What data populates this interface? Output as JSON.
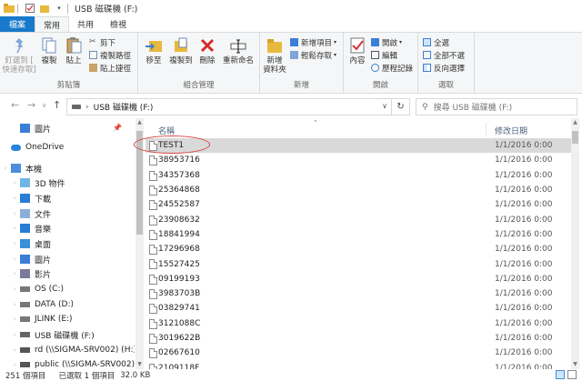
{
  "title": "USB 磁碟機 (F:)",
  "tabs": [
    "檔案",
    "常用",
    "共用",
    "檢視"
  ],
  "ribbon": {
    "clipboard": {
      "label": "剪貼簿",
      "pin": "釘選到 [\n快速存取]",
      "copy": "複製",
      "paste": "貼上",
      "cut": "剪下",
      "copy_path": "複製路徑",
      "paste_shortcut": "貼上捷徑"
    },
    "organize": {
      "label": "組合管理",
      "move_to": "移至",
      "copy_to": "複製到",
      "delete": "刪除",
      "rename": "重新命名"
    },
    "new": {
      "label": "新增",
      "new_folder": "新增\n資料夾",
      "new_item": "新增項目",
      "easy_access": "輕鬆存取"
    },
    "open": {
      "label": "開啟",
      "properties": "內容",
      "open": "開啟",
      "edit": "編輯",
      "history": "歷程記錄"
    },
    "select": {
      "label": "選取",
      "select_all": "全選",
      "select_none": "全部不選",
      "invert": "反向選擇"
    }
  },
  "address": {
    "drive": "USB 磁碟機 (F:)",
    "search_placeholder": "搜尋 USB 磁碟機 (F:)"
  },
  "nav": [
    {
      "label": "圖片",
      "icon": "pictures-icon"
    },
    {
      "label": "OneDrive",
      "icon": "onedrive-icon"
    },
    {
      "label": "本機",
      "icon": "this-pc-icon"
    },
    {
      "label": "3D 物件",
      "icon": "3d-objects-icon"
    },
    {
      "label": "下載",
      "icon": "downloads-icon"
    },
    {
      "label": "文件",
      "icon": "documents-icon"
    },
    {
      "label": "音樂",
      "icon": "music-icon"
    },
    {
      "label": "桌面",
      "icon": "desktop-icon"
    },
    {
      "label": "圖片",
      "icon": "pictures-icon"
    },
    {
      "label": "影片",
      "icon": "videos-icon"
    },
    {
      "label": "OS (C:)",
      "icon": "drive-icon"
    },
    {
      "label": "DATA (D:)",
      "icon": "drive-icon"
    },
    {
      "label": "JLINK (E:)",
      "icon": "drive-icon"
    },
    {
      "label": "USB 磁碟機 (F:)",
      "icon": "usb-drive-icon"
    },
    {
      "label": "rd (\\\\SIGMA-SRV002) (H:)",
      "icon": "network-drive-icon"
    },
    {
      "label": "public (\\\\SIGMA-SRV002)",
      "icon": "network-drive-icon"
    }
  ],
  "columns": {
    "name": "名稱",
    "date": "修改日期"
  },
  "files": [
    {
      "name": "TEST1",
      "date": "1/1/2016 0:00"
    },
    {
      "name": "38953716",
      "date": "1/1/2016 0:00"
    },
    {
      "name": "34357368",
      "date": "1/1/2016 0:00"
    },
    {
      "name": "25364868",
      "date": "1/1/2016 0:00"
    },
    {
      "name": "24552587",
      "date": "1/1/2016 0:00"
    },
    {
      "name": "23908632",
      "date": "1/1/2016 0:00"
    },
    {
      "name": "18841994",
      "date": "1/1/2016 0:00"
    },
    {
      "name": "17296968",
      "date": "1/1/2016 0:00"
    },
    {
      "name": "15527425",
      "date": "1/1/2016 0:00"
    },
    {
      "name": "09199193",
      "date": "1/1/2016 0:00"
    },
    {
      "name": "3983703B",
      "date": "1/1/2016 0:00"
    },
    {
      "name": "03829741",
      "date": "1/1/2016 0:00"
    },
    {
      "name": "3121088C",
      "date": "1/1/2016 0:00"
    },
    {
      "name": "3019622B",
      "date": "1/1/2016 0:00"
    },
    {
      "name": "02667610",
      "date": "1/1/2016 0:00"
    },
    {
      "name": "2109118F",
      "date": "1/1/2016 0:00"
    }
  ],
  "status": {
    "count": "251 個項目",
    "selected": "已選取 1 個項目",
    "size": "32.0 KB"
  },
  "colors": {
    "accent": "#1979ca",
    "selection": "#d9d9d9",
    "annotation": "#d94545"
  }
}
